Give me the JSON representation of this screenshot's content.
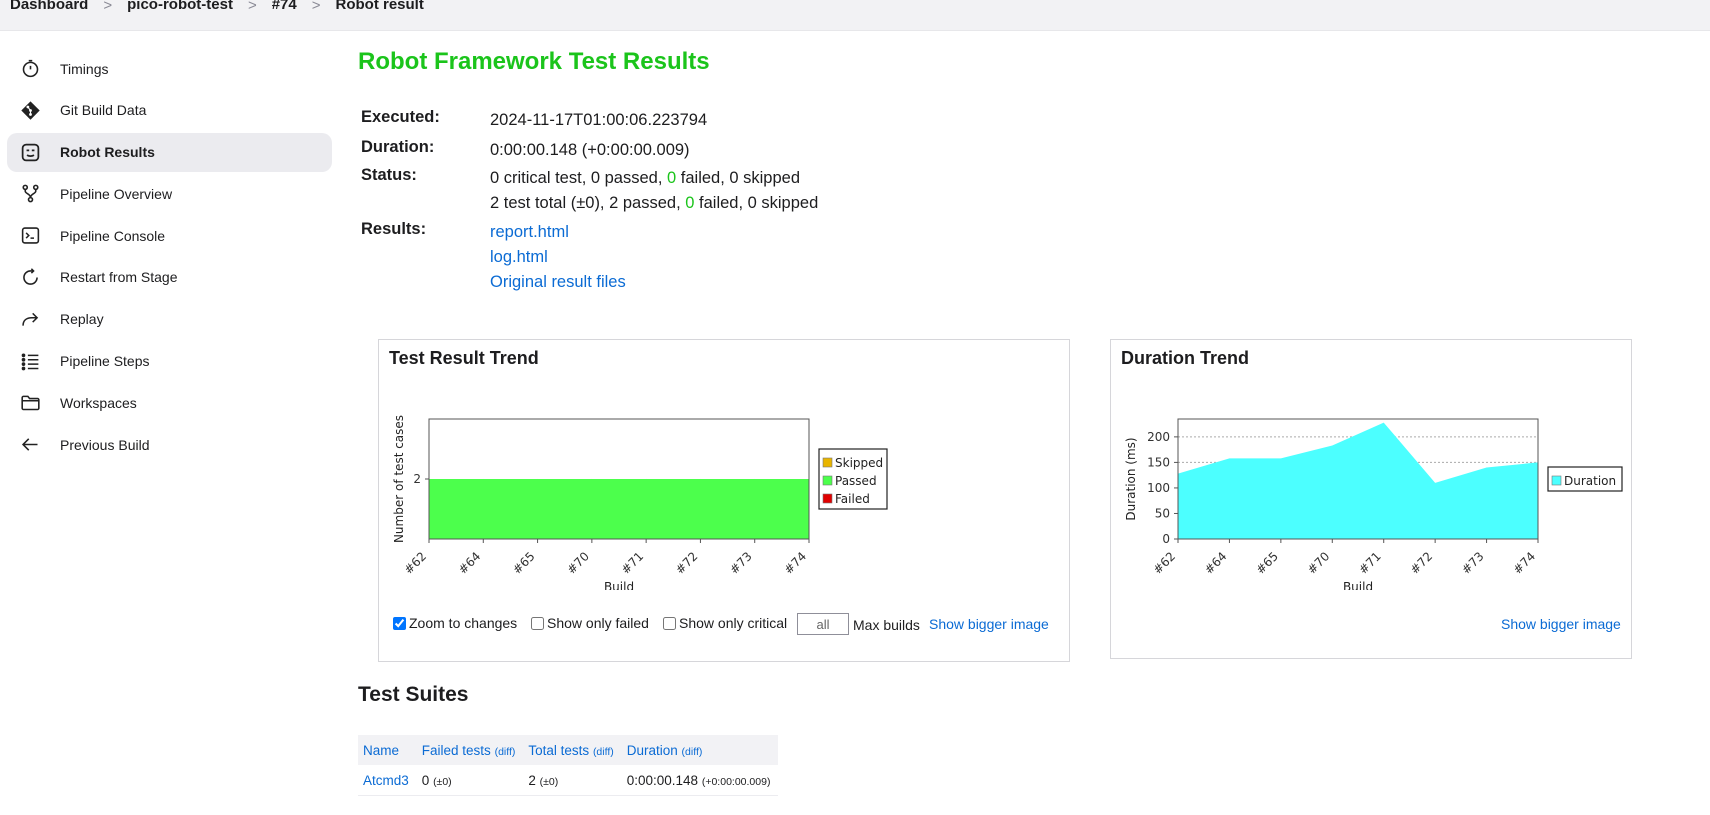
{
  "breadcrumb": [
    "Dashboard",
    "pico-robot-test",
    "#74",
    "Robot result"
  ],
  "sidebar": {
    "items": [
      {
        "label": "Timings",
        "icon": "timer-icon"
      },
      {
        "label": "Git Build Data",
        "icon": "git-icon"
      },
      {
        "label": "Robot Results",
        "icon": "robot-icon",
        "active": true
      },
      {
        "label": "Pipeline Overview",
        "icon": "branch-icon"
      },
      {
        "label": "Pipeline Console",
        "icon": "terminal-icon"
      },
      {
        "label": "Restart from Stage",
        "icon": "restart-icon"
      },
      {
        "label": "Replay",
        "icon": "replay-icon"
      },
      {
        "label": "Pipeline Steps",
        "icon": "steps-icon"
      },
      {
        "label": "Workspaces",
        "icon": "folder-icon"
      },
      {
        "label": "Previous Build",
        "icon": "arrow-left-icon"
      }
    ]
  },
  "main": {
    "title": "Robot Framework Test Results",
    "executed_label": "Executed:",
    "executed_value": "2024-11-17T01:00:06.223794",
    "duration_label": "Duration:",
    "duration_value": "0:00:00.148 (+0:00:00.009)",
    "status_label": "Status:",
    "status_line1": {
      "a": "0 critical test, 0 passed, ",
      "failed": "0",
      "b": " failed, 0 skipped"
    },
    "status_line2": {
      "a": "2 test total (±0), 2 passed, ",
      "failed": "0",
      "b": " failed, 0 skipped"
    },
    "results_label": "Results:",
    "result_links": [
      "report.html",
      "log.html",
      "Original result files"
    ]
  },
  "trend": {
    "title": "Test Result Trend",
    "controls": {
      "zoom": "Zoom to changes",
      "zoom_checked": true,
      "only_failed": "Show only failed",
      "only_critical": "Show only critical",
      "max_builds_value": "all",
      "max_builds_label": "Max builds",
      "bigger": "Show bigger image"
    }
  },
  "duration": {
    "title": "Duration Trend",
    "bigger": "Show bigger image"
  },
  "chart_data": [
    {
      "type": "area",
      "title": "",
      "xlabel": "Build",
      "ylabel": "Number of test cases",
      "categories": [
        "#62",
        "#64",
        "#65",
        "#70",
        "#71",
        "#72",
        "#73",
        "#74"
      ],
      "series": [
        {
          "name": "Skipped",
          "values": [
            0,
            0,
            0,
            0,
            0,
            0,
            0,
            0
          ],
          "color": "#e8b500"
        },
        {
          "name": "Passed",
          "values": [
            2,
            2,
            2,
            2,
            2,
            2,
            2,
            2
          ],
          "color": "#4cff4c"
        },
        {
          "name": "Failed",
          "values": [
            0,
            0,
            0,
            0,
            0,
            0,
            0,
            0
          ],
          "color": "#e00000"
        }
      ],
      "yticks": [
        2
      ],
      "ylim": [
        0,
        4
      ],
      "legend": "right"
    },
    {
      "type": "area",
      "title": "",
      "xlabel": "Build",
      "ylabel": "Duration (ms)",
      "categories": [
        "#62",
        "#64",
        "#65",
        "#70",
        "#71",
        "#72",
        "#73",
        "#74"
      ],
      "series": [
        {
          "name": "Duration",
          "values": [
            128,
            158,
            158,
            183,
            228,
            110,
            140,
            150
          ],
          "color": "#4cffff"
        }
      ],
      "yticks": [
        0,
        50,
        100,
        150,
        200
      ],
      "ylim": [
        0,
        235
      ],
      "grid": true,
      "legend": "right"
    }
  ],
  "suites": {
    "title": "Test Suites",
    "headers": [
      {
        "label": "Name",
        "diff": ""
      },
      {
        "label": "Failed tests",
        "diff": "(diff)"
      },
      {
        "label": "Total tests",
        "diff": "(diff)"
      },
      {
        "label": "Duration",
        "diff": "(diff)"
      }
    ],
    "rows": [
      {
        "name": "Atcmd3",
        "failed": "0",
        "failed_diff": "(±0)",
        "total": "2",
        "total_diff": "(±0)",
        "duration": "0:00:00.148",
        "duration_diff": "(+0:00:00.009)"
      }
    ]
  }
}
